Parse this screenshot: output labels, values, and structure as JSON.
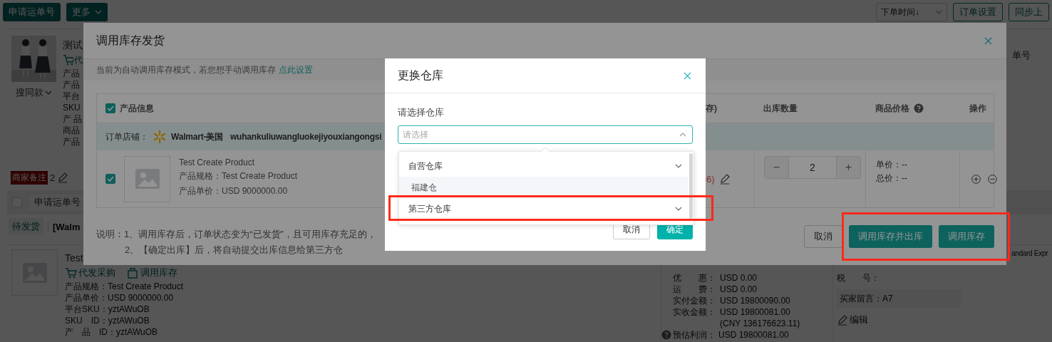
{
  "toolbar": {
    "buttons": [
      {
        "label": "申请运单号",
        "dropdown": false
      },
      {
        "label": "更多",
        "dropdown": true
      }
    ],
    "sort": {
      "value": "下单时间↓"
    },
    "actions": [
      "订单设置",
      "同步上"
    ]
  },
  "order_1": {
    "title": "测试",
    "purchase_tag": "代",
    "search_similar": "搜同款",
    "field_labels": [
      "产品",
      "产品",
      "平台",
      "SKU",
      "产 品",
      "商品",
      "产品"
    ],
    "side_text": "单号"
  },
  "merchant_note": {
    "label": "商家备注",
    "count": "2"
  },
  "batch_bar": {
    "checked": false,
    "button": "申请运单号"
  },
  "order_2": {
    "status": "待发货",
    "store": "[Walm",
    "title": "Test",
    "actions": [
      {
        "kind": "cart",
        "label": "代发采购"
      },
      {
        "kind": "box",
        "label": "调用库存"
      }
    ],
    "fields": [
      {
        "label": "产品规格：",
        "value": "Test Create Product"
      },
      {
        "label": "产品单价：",
        "value": "USD 9000000.00"
      },
      {
        "label": "平台SKU：",
        "value": "yztAWuOB"
      },
      {
        "label": "SKU　ID：",
        "value": "yztAWuOB"
      },
      {
        "label": "产　品　ID：",
        "value": "yztAWuOB"
      }
    ],
    "amounts": [
      {
        "kind": "line",
        "label": "优　　惠：",
        "value": "USD 0.00"
      },
      {
        "kind": "line",
        "label": "运　　费：",
        "value": "USD 0.00"
      },
      {
        "kind": "line",
        "label": "实付金额：",
        "value": "USD 19800090.00"
      },
      {
        "kind": "line",
        "label": "实收金额：",
        "value": "USD 19800081.00"
      },
      {
        "kind": "note",
        "value": "(CNY 136176623.11)"
      },
      {
        "kind": "help",
        "label": "预估利润：",
        "value": "USD 19800081.00"
      }
    ],
    "buyer": {
      "tax_label": "税　　号：",
      "message_label": "买家留言：",
      "message": "A7",
      "edit": "编辑"
    },
    "shipping": "andard Expr"
  },
  "stock_dialog": {
    "title": "调用库存发货",
    "notice": "当前为自动调用库存模式，若您想手动调用库存",
    "notice_link": "点此设置",
    "columns": [
      {
        "kind": "check",
        "label": "产品信息",
        "checked": true
      },
      {
        "kind": "text",
        "label": "存)"
      },
      {
        "kind": "text",
        "label": "出库数量"
      },
      {
        "kind": "help",
        "label": "商品价格"
      },
      {
        "kind": "text",
        "label": "操作"
      }
    ],
    "store": {
      "label": "订单店铺：",
      "platform": "Walmart-美国",
      "account": "wuhankuliuwangluokejiyouxiangongsi"
    },
    "product": {
      "checked": true,
      "name": "Test Create Product",
      "spec": "产品规格：Test Create Product",
      "price": "产品单价：USD 9000000.00",
      "stock": "6)",
      "decrement": "−",
      "quantity": "2",
      "increment": "+",
      "unit_price": "单价：--",
      "total_price": "总价：--"
    },
    "notes": [
      "说明：1、调用库存后，订单状态变为“已发货”，且可用库存充足的，",
      "2、【确定出库】后，将自动提交出库信息给第三方仓"
    ],
    "buttons": [
      {
        "label": "取消",
        "primary": false
      },
      {
        "label": "调用库存并出库",
        "primary": true,
        "framed": true
      },
      {
        "label": "调用库存",
        "primary": true,
        "framed": true
      }
    ]
  },
  "warehouse_dialog": {
    "title": "更换仓库",
    "field_label": "请选择仓库",
    "select": {
      "placeholder": "请选择",
      "open": true
    },
    "options": [
      {
        "label": "自营仓库",
        "children": [
          {
            "label": "福建仓",
            "highlighted": true
          }
        ]
      },
      {
        "label": "第三方仓库",
        "framed": true
      }
    ],
    "buttons": [
      {
        "label": "取消",
        "primary": false
      },
      {
        "label": "确定",
        "primary": true
      }
    ]
  }
}
